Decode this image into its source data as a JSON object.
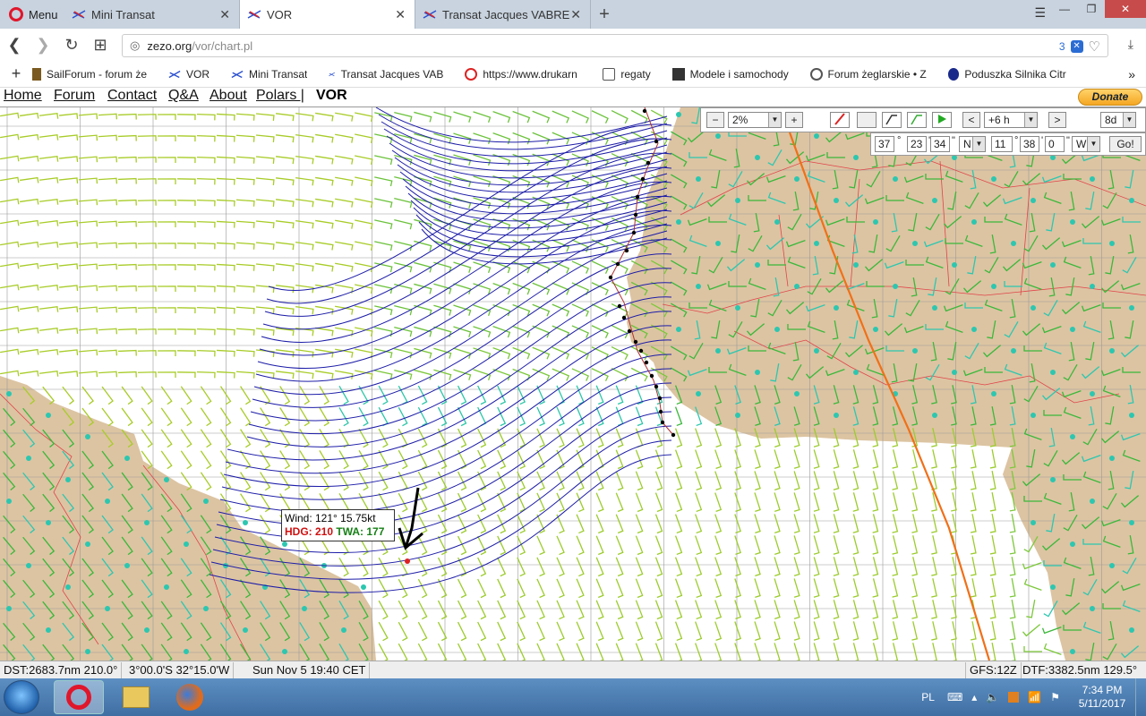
{
  "browser": {
    "menu_label": "Menu",
    "tabs": [
      {
        "title": "Mini Transat",
        "active": false
      },
      {
        "title": "VOR",
        "active": true
      },
      {
        "title": "Transat Jacques VABRE",
        "active": false
      }
    ],
    "url_host": "zezo.org",
    "url_path": "/vor/chart.pl",
    "badge_count": "3",
    "bookmarks": [
      "SailForum - forum że",
      "VOR",
      "Mini Transat",
      "Transat Jacques VAB",
      "https://www.drukarn",
      "regaty",
      "Modele i samochody",
      "Forum żeglarskie • Z",
      "Poduszka Silnika Citr"
    ]
  },
  "sitenav": {
    "links": [
      "Home",
      "Forum",
      "Contact",
      "Q&A",
      "About",
      "Polars |"
    ],
    "brand": "VOR",
    "donate": "Donate"
  },
  "controls": {
    "zoom_minus": "−",
    "zoom_value": "2%",
    "zoom_plus": "+",
    "time_prev": "<",
    "time_step": "+6 h",
    "time_next": ">",
    "range": "8d",
    "lat_deg": "37",
    "lat_min": "23",
    "lat_sec": "34",
    "lat_hem": "N",
    "lon_deg": "11",
    "lon_min": "38",
    "lon_sec": "0",
    "lon_hem": "W",
    "go": "Go!",
    "deg_sym": "°",
    "min_sym": "'",
    "sec_sym": "\""
  },
  "tooltip": {
    "wind": "Wind: 121° 15.75kt",
    "hdg": "HDG: 210",
    "twa": "TWA: 177"
  },
  "status": {
    "dst": "DST:2683.7nm 210.0°",
    "position": "3°00.0'S  32°15.0'W",
    "time": "Sun Nov  5 19:40 CET",
    "gfs": "GFS:12Z",
    "dtf": "DTF:3382.5nm 129.5°"
  },
  "taskbar": {
    "lang": "PL",
    "time": "7:34 PM",
    "date": "5/11/2017"
  },
  "colors": {
    "land": "#dcc4a2",
    "border": "#e0444a",
    "isochrone": "#1c1ca8",
    "great_circle": "#f07018"
  }
}
